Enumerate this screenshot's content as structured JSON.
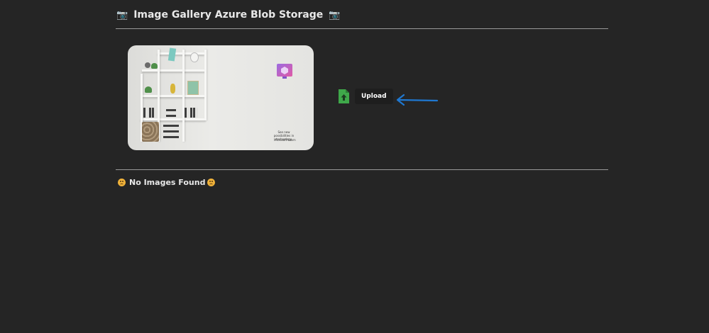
{
  "header": {
    "title": "Image Gallery Azure Blob Storage",
    "leading_icon": "camera-emoji",
    "trailing_icon": "camera-emoji"
  },
  "hero_image": {
    "tagline": "See new possibilities in technology",
    "brand": "Microsoft Learn"
  },
  "upload": {
    "icon": "file-upload-icon",
    "button_label": "Upload",
    "pointer": "arrow-left-icon"
  },
  "gallery": {
    "empty_message": "No Images Found",
    "empty_icon": "slightly-frowning-face-emoji"
  },
  "colors": {
    "background": "#252525",
    "text": "#e8e8e8",
    "divider": "#9a9a9a",
    "upload_icon": "#3fa84a",
    "arrow": "#1f78d1"
  }
}
